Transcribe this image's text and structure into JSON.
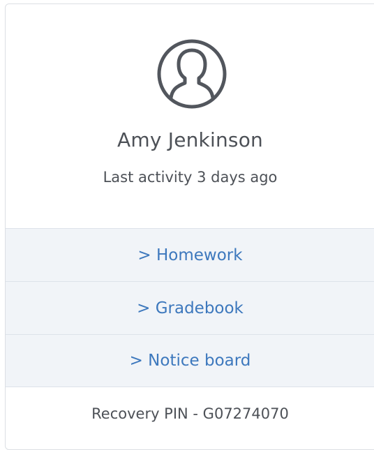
{
  "profile": {
    "avatar_icon": "user-silhouette-icon",
    "name": "Amy Jenkinson",
    "last_activity": "Last activity 3 days ago"
  },
  "links": {
    "homework": "> Homework",
    "gradebook": "> Gradebook",
    "notice_board": "> Notice board"
  },
  "recovery_pin": "Recovery PIN - G07274070",
  "colors": {
    "link": "#3d78bd",
    "link_row_bg": "#f1f4f8",
    "text": "#4d5157",
    "border": "#dde2ea"
  }
}
